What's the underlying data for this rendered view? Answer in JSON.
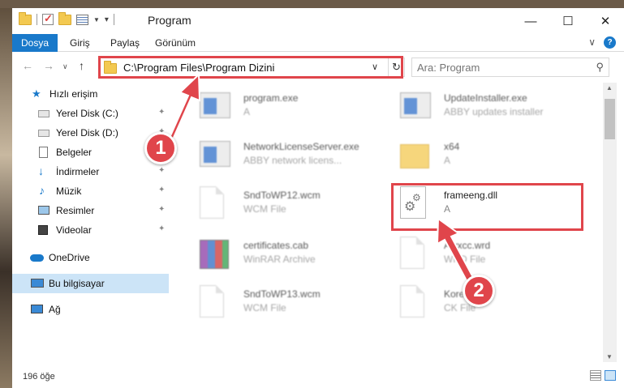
{
  "titlebar": {
    "title": "Program",
    "minimize": "—",
    "maximize": "☐",
    "close": "✕"
  },
  "ribbon": {
    "tabs": [
      "Dosya",
      "Giriş",
      "Paylaş",
      "Görünüm"
    ],
    "expand": "∨",
    "help": "?"
  },
  "nav": {
    "back": "←",
    "forward": "→",
    "recent": "∨",
    "up": "↑",
    "address": "C:\\Program Files\\Program Dizini",
    "address_dropdown": "∨",
    "refresh": "↻",
    "search_placeholder": "Ara: Program",
    "search_icon": "⚲"
  },
  "sidebar": {
    "items": [
      {
        "label": "Hızlı erişim",
        "icon": "star-icon"
      },
      {
        "label": "Yerel Disk (C:)",
        "icon": "drive-icon",
        "pinned": true
      },
      {
        "label": "Yerel Disk (D:)",
        "icon": "drive-icon",
        "pinned": true
      },
      {
        "label": "Belgeler",
        "icon": "documents-icon",
        "pinned": true
      },
      {
        "label": "İndirmeler",
        "icon": "download-icon",
        "pinned": true
      },
      {
        "label": "Müzik",
        "icon": "music-icon",
        "pinned": true
      },
      {
        "label": "Resimler",
        "icon": "pictures-icon",
        "pinned": true
      },
      {
        "label": "Videolar",
        "icon": "videos-icon",
        "pinned": true
      },
      {
        "label": "OneDrive",
        "icon": "onedrive-icon"
      },
      {
        "label": "Bu bilgisayar",
        "icon": "computer-icon",
        "selected": true
      },
      {
        "label": "Ağ",
        "icon": "network-icon"
      }
    ],
    "pin_glyph": "📌"
  },
  "files": [
    {
      "name": "program.exe",
      "desc": "A",
      "icon": "exe-icon"
    },
    {
      "name": "UpdateInstaller.exe",
      "desc": "ABBY updates installer",
      "icon": "app-icon"
    },
    {
      "name": "NetworkLicenseServer.exe",
      "desc": "ABBY network licens...",
      "icon": "app-icon"
    },
    {
      "name": "x64",
      "desc": "A",
      "icon": "folder-icon"
    },
    {
      "name": "SndToWP12.wcm",
      "desc": "WCM File",
      "icon": "document-icon"
    },
    {
      "name": "frameeng.dll",
      "desc": "A",
      "icon": "dll-icon"
    },
    {
      "name": "certificates.cab",
      "desc": "WinRAR Archive",
      "icon": "winrar-icon"
    },
    {
      "name": "Awxcc.wrd",
      "desc": "WRD File",
      "icon": "document-icon"
    },
    {
      "name": "SndToWP13.wcm",
      "desc": "WCM File",
      "icon": "document-icon"
    },
    {
      "name": "Korea...",
      "desc": "CK File",
      "icon": "document-icon"
    }
  ],
  "status": {
    "count": "196 öğe"
  },
  "annotations": {
    "badge1": "1",
    "badge2": "2",
    "color": "#e0454b"
  }
}
